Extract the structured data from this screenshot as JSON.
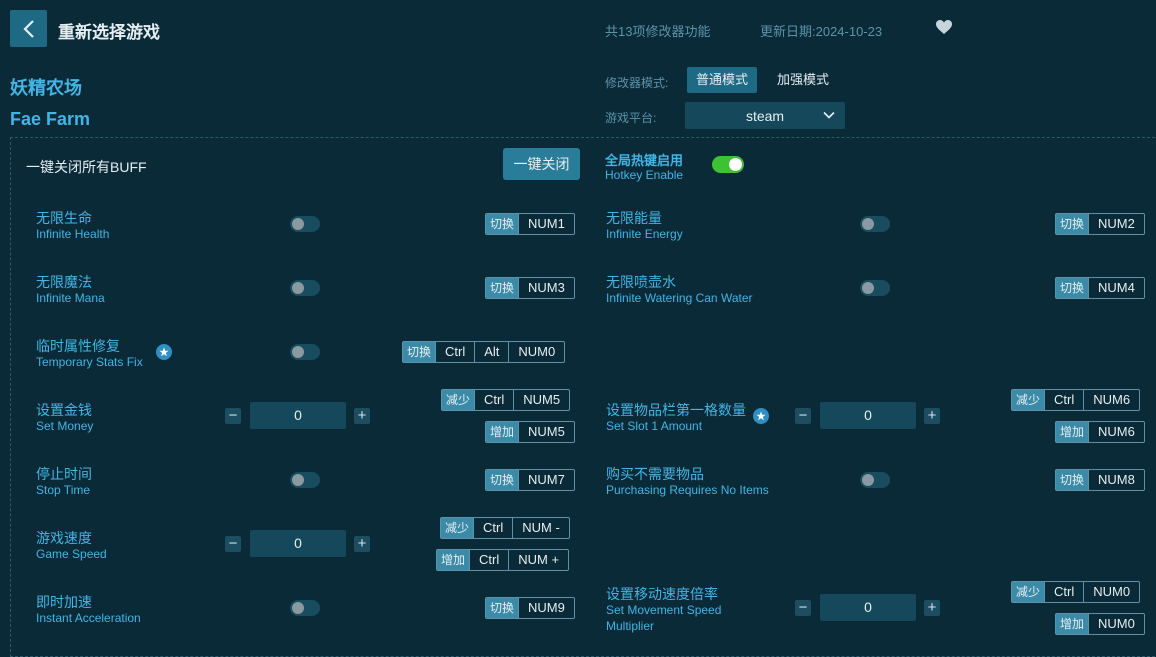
{
  "header": {
    "title": "重新选择游戏",
    "feature_count": "共13项修改器功能",
    "update_date": "更新日期:2024-10-23"
  },
  "game": {
    "name_cn": "妖精农场",
    "name_en": "Fae Farm"
  },
  "mode": {
    "label": "修改器模式:",
    "normal": "普通模式",
    "enhanced": "加强模式",
    "selected": "普通模式"
  },
  "platform": {
    "label": "游戏平台:",
    "value": "steam"
  },
  "global": {
    "buff_label": "一键关闭所有BUFF",
    "close_button": "一键关闭",
    "hotkey_cn": "全局热键启用",
    "hotkey_en": "Hotkey Enable",
    "hotkey_enabled": true
  },
  "labels": {
    "toggle": "切换",
    "decrease": "减少",
    "increase": "增加"
  },
  "features": [
    {
      "cn": "无限生命",
      "en": "Infinite Health",
      "keys": [
        "NUM1"
      ]
    },
    {
      "cn": "无限能量",
      "en": "Infinite Energy",
      "keys": [
        "NUM2"
      ]
    },
    {
      "cn": "无限魔法",
      "en": "Infinite Mana",
      "keys": [
        "NUM3"
      ]
    },
    {
      "cn": "无限喷壶水",
      "en": "Infinite Watering Can Water",
      "keys": [
        "NUM4"
      ]
    },
    {
      "cn": "临时属性修复",
      "en": "Temporary Stats Fix",
      "keys": [
        "Ctrl",
        "Alt",
        "NUM0"
      ]
    },
    {
      "cn": "设置金钱",
      "en": "Set Money",
      "value": "0",
      "dec_keys": [
        "Ctrl",
        "NUM5"
      ],
      "inc_keys": [
        "NUM5"
      ]
    },
    {
      "cn": "设置物品栏第一格数量",
      "en": "Set Slot 1 Amount",
      "value": "0",
      "dec_keys": [
        "Ctrl",
        "NUM6"
      ],
      "inc_keys": [
        "NUM6"
      ]
    },
    {
      "cn": "停止时间",
      "en": "Stop Time",
      "keys": [
        "NUM7"
      ]
    },
    {
      "cn": "购买不需要物品",
      "en": "Purchasing Requires No Items",
      "keys": [
        "NUM8"
      ]
    },
    {
      "cn": "游戏速度",
      "en": "Game Speed",
      "value": "0",
      "dec_keys": [
        "Ctrl",
        "NUM -"
      ],
      "inc_keys": [
        "Ctrl",
        "NUM +"
      ]
    },
    {
      "cn": "即时加速",
      "en": "Instant Acceleration",
      "keys": [
        "NUM9"
      ]
    },
    {
      "cn": "设置移动速度倍率",
      "en_line1": "Set Movement Speed",
      "en_line2": "Multiplier",
      "value": "0",
      "dec_keys": [
        "Ctrl",
        "NUM0"
      ],
      "inc_keys": [
        "NUM0"
      ]
    }
  ],
  "colors": {
    "background": "#0a2a38",
    "accent": "#41b5e4",
    "button": "#1e6a84",
    "toggle_on": "#3ec234"
  }
}
